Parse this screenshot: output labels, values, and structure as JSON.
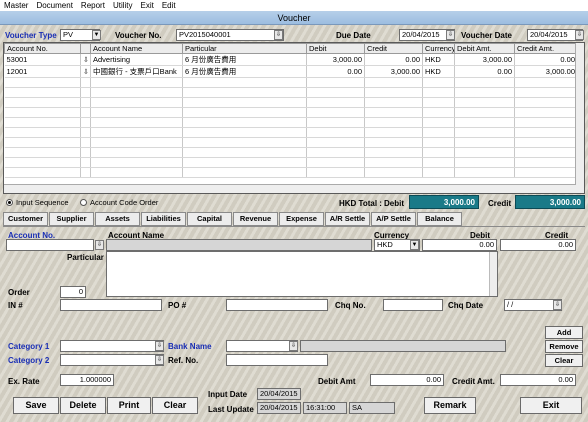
{
  "menu": [
    "Master",
    "Document",
    "Report",
    "Utility",
    "Exit",
    "Edit"
  ],
  "window_title": "Voucher",
  "header": {
    "voucher_type_label": "Voucher Type",
    "voucher_type_value": "PV",
    "voucher_no_label": "Voucher No.",
    "voucher_no_value": "PV2015040001",
    "due_date_label": "Due Date",
    "due_date_value": "20/04/2015",
    "voucher_date_label": "Voucher Date",
    "voucher_date_value": "20/04/2015"
  },
  "grid": {
    "columns": [
      "Account No.",
      "Account Name",
      "Particular",
      "Debit",
      "Credit",
      "Currency",
      "Debit Amt.",
      "Credit Amt."
    ],
    "rows": [
      {
        "account_no": "53001",
        "account_name": "Advertising",
        "particular": "6 月份廣告費用",
        "debit": "3,000.00",
        "credit": "0.00",
        "currency": "HKD",
        "debit_amt": "3,000.00",
        "credit_amt": "0.00"
      },
      {
        "account_no": "12001",
        "account_name": "中國銀行 - 支票戶口Bank",
        "particular": "6 月份廣告費用",
        "debit": "0.00",
        "credit": "3,000.00",
        "currency": "HKD",
        "debit_amt": "0.00",
        "credit_amt": "3,000.00"
      }
    ]
  },
  "sequence": {
    "input_sequence": "Input Sequence",
    "account_code_order": "Account Code Order"
  },
  "totals": {
    "label": "HKD Total :",
    "debit_label": "Debit",
    "debit_value": "3,000.00",
    "credit_label": "Credit",
    "credit_value": "3,000.00"
  },
  "tabs": [
    "Customer",
    "Supplier",
    "Assets",
    "Liabilities",
    "Capital",
    "Revenue",
    "Expense",
    "A/R Settle",
    "A/P Settle",
    "Balance"
  ],
  "detail": {
    "account_no_label": "Account No.",
    "account_name_label": "Account Name",
    "currency_label": "Currency",
    "currency_value": "HKD",
    "debit_label": "Debit",
    "debit_value": "0.00",
    "credit_label": "Credit",
    "credit_value": "0.00",
    "particular_label": "Particular",
    "order_label": "Order",
    "order_value": "0",
    "in_label": "IN #",
    "po_label": "PO #",
    "chq_no_label": "Chq No.",
    "chq_date_label": "Chq Date",
    "chq_date_value": "/ /",
    "category1_label": "Category 1",
    "category2_label": "Category 2",
    "bank_name_label": "Bank Name",
    "ref_no_label": "Ref. No.",
    "add": "Add",
    "remove": "Remove",
    "clear_small": "Clear",
    "ex_rate_label": "Ex. Rate",
    "ex_rate_value": "1.000000",
    "debit_amt_label": "Debit Amt",
    "debit_amt_value": "0.00",
    "credit_amt_label": "Credit Amt.",
    "credit_amt_value": "0.00",
    "input_date_label": "Input Date",
    "input_date_value": "20/04/2015",
    "last_update_label": "Last Update",
    "last_update_date": "20/04/2015",
    "last_update_time": "16:31:00",
    "last_update_user": "SA"
  },
  "buttons": {
    "save": "Save",
    "delete": "Delete",
    "print": "Print",
    "clear": "Clear",
    "remark": "Remark",
    "exit": "Exit"
  }
}
